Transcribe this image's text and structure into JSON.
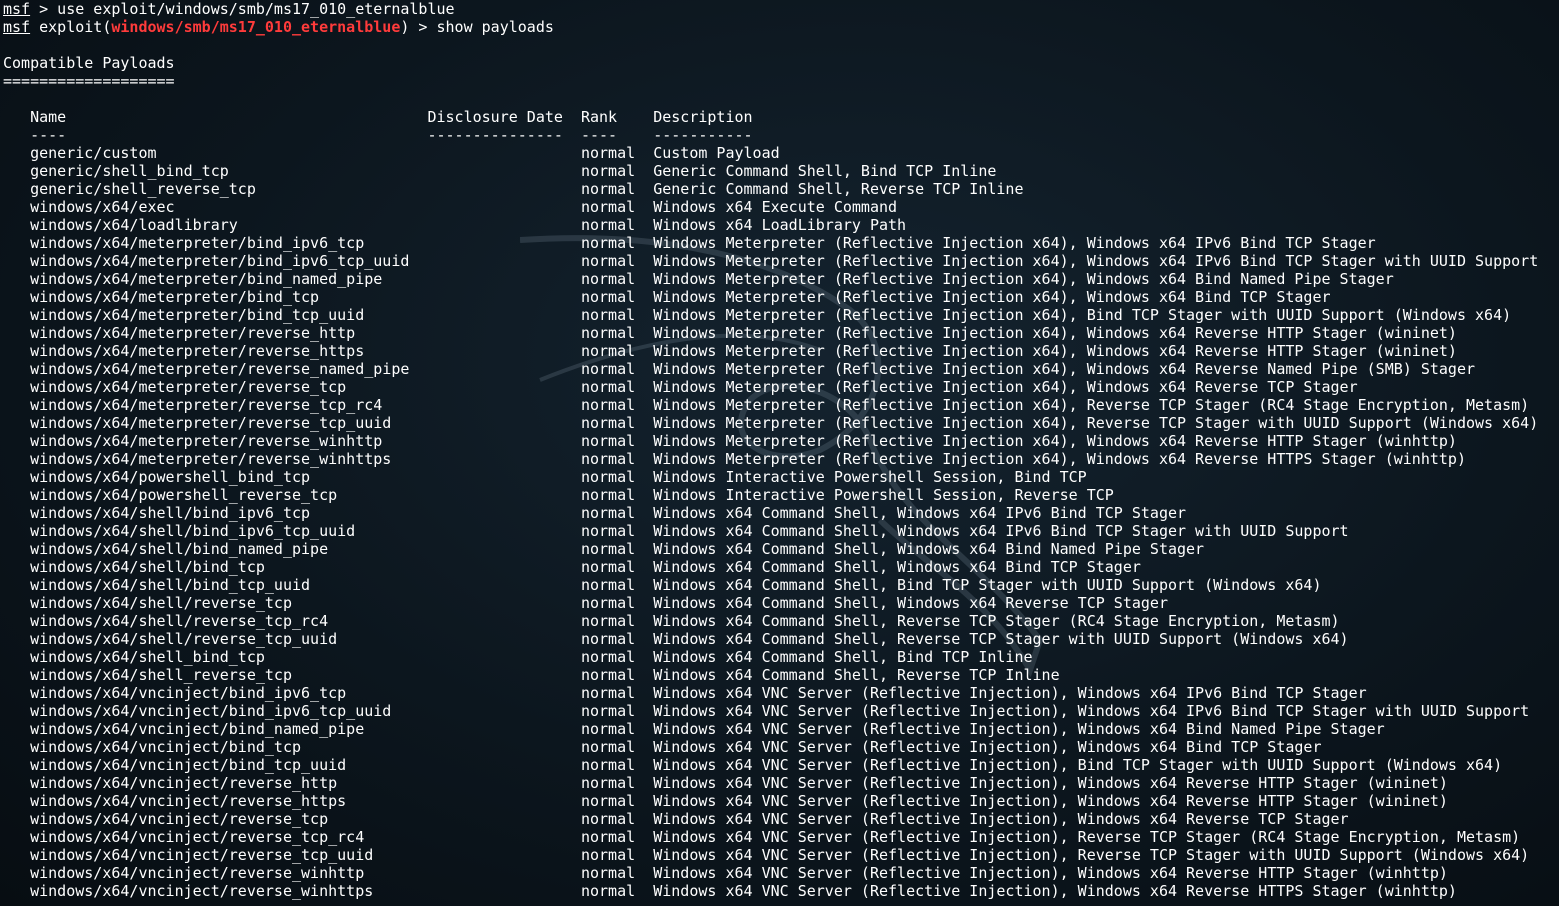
{
  "prompt": {
    "line1": {
      "msf": "msf",
      "rest": " > use exploit/windows/smb/ms17_010_eternalblue"
    },
    "line2": {
      "msf": "msf",
      "pre": " exploit(",
      "module": "windows/smb/ms17_010_eternalblue",
      "post": ") > show payloads"
    }
  },
  "section": {
    "title": "Compatible Payloads",
    "underline": "==================="
  },
  "table": {
    "header": "   Name                                        Disclosure Date  Rank    Description",
    "divider": "   ----                                        ---------------  ----    -----------",
    "rows": [
      "   generic/custom                                               normal  Custom Payload",
      "   generic/shell_bind_tcp                                       normal  Generic Command Shell, Bind TCP Inline",
      "   generic/shell_reverse_tcp                                    normal  Generic Command Shell, Reverse TCP Inline",
      "   windows/x64/exec                                             normal  Windows x64 Execute Command",
      "   windows/x64/loadlibrary                                      normal  Windows x64 LoadLibrary Path",
      "   windows/x64/meterpreter/bind_ipv6_tcp                        normal  Windows Meterpreter (Reflective Injection x64), Windows x64 IPv6 Bind TCP Stager",
      "   windows/x64/meterpreter/bind_ipv6_tcp_uuid                   normal  Windows Meterpreter (Reflective Injection x64), Windows x64 IPv6 Bind TCP Stager with UUID Support",
      "   windows/x64/meterpreter/bind_named_pipe                      normal  Windows Meterpreter (Reflective Injection x64), Windows x64 Bind Named Pipe Stager",
      "   windows/x64/meterpreter/bind_tcp                             normal  Windows Meterpreter (Reflective Injection x64), Windows x64 Bind TCP Stager",
      "   windows/x64/meterpreter/bind_tcp_uuid                        normal  Windows Meterpreter (Reflective Injection x64), Bind TCP Stager with UUID Support (Windows x64)",
      "   windows/x64/meterpreter/reverse_http                         normal  Windows Meterpreter (Reflective Injection x64), Windows x64 Reverse HTTP Stager (wininet)",
      "   windows/x64/meterpreter/reverse_https                        normal  Windows Meterpreter (Reflective Injection x64), Windows x64 Reverse HTTP Stager (wininet)",
      "   windows/x64/meterpreter/reverse_named_pipe                   normal  Windows Meterpreter (Reflective Injection x64), Windows x64 Reverse Named Pipe (SMB) Stager",
      "   windows/x64/meterpreter/reverse_tcp                          normal  Windows Meterpreter (Reflective Injection x64), Windows x64 Reverse TCP Stager",
      "   windows/x64/meterpreter/reverse_tcp_rc4                      normal  Windows Meterpreter (Reflective Injection x64), Reverse TCP Stager (RC4 Stage Encryption, Metasm)",
      "   windows/x64/meterpreter/reverse_tcp_uuid                     normal  Windows Meterpreter (Reflective Injection x64), Reverse TCP Stager with UUID Support (Windows x64)",
      "   windows/x64/meterpreter/reverse_winhttp                      normal  Windows Meterpreter (Reflective Injection x64), Windows x64 Reverse HTTP Stager (winhttp)",
      "   windows/x64/meterpreter/reverse_winhttps                     normal  Windows Meterpreter (Reflective Injection x64), Windows x64 Reverse HTTPS Stager (winhttp)",
      "   windows/x64/powershell_bind_tcp                              normal  Windows Interactive Powershell Session, Bind TCP",
      "   windows/x64/powershell_reverse_tcp                           normal  Windows Interactive Powershell Session, Reverse TCP",
      "   windows/x64/shell/bind_ipv6_tcp                              normal  Windows x64 Command Shell, Windows x64 IPv6 Bind TCP Stager",
      "   windows/x64/shell/bind_ipv6_tcp_uuid                         normal  Windows x64 Command Shell, Windows x64 IPv6 Bind TCP Stager with UUID Support",
      "   windows/x64/shell/bind_named_pipe                            normal  Windows x64 Command Shell, Windows x64 Bind Named Pipe Stager",
      "   windows/x64/shell/bind_tcp                                   normal  Windows x64 Command Shell, Windows x64 Bind TCP Stager",
      "   windows/x64/shell/bind_tcp_uuid                              normal  Windows x64 Command Shell, Bind TCP Stager with UUID Support (Windows x64)",
      "   windows/x64/shell/reverse_tcp                                normal  Windows x64 Command Shell, Windows x64 Reverse TCP Stager",
      "   windows/x64/shell/reverse_tcp_rc4                            normal  Windows x64 Command Shell, Reverse TCP Stager (RC4 Stage Encryption, Metasm)",
      "   windows/x64/shell/reverse_tcp_uuid                           normal  Windows x64 Command Shell, Reverse TCP Stager with UUID Support (Windows x64)",
      "   windows/x64/shell_bind_tcp                                   normal  Windows x64 Command Shell, Bind TCP Inline",
      "   windows/x64/shell_reverse_tcp                                normal  Windows x64 Command Shell, Reverse TCP Inline",
      "   windows/x64/vncinject/bind_ipv6_tcp                          normal  Windows x64 VNC Server (Reflective Injection), Windows x64 IPv6 Bind TCP Stager",
      "   windows/x64/vncinject/bind_ipv6_tcp_uuid                     normal  Windows x64 VNC Server (Reflective Injection), Windows x64 IPv6 Bind TCP Stager with UUID Support",
      "   windows/x64/vncinject/bind_named_pipe                        normal  Windows x64 VNC Server (Reflective Injection), Windows x64 Bind Named Pipe Stager",
      "   windows/x64/vncinject/bind_tcp                               normal  Windows x64 VNC Server (Reflective Injection), Windows x64 Bind TCP Stager",
      "   windows/x64/vncinject/bind_tcp_uuid                          normal  Windows x64 VNC Server (Reflective Injection), Bind TCP Stager with UUID Support (Windows x64)",
      "   windows/x64/vncinject/reverse_http                           normal  Windows x64 VNC Server (Reflective Injection), Windows x64 Reverse HTTP Stager (wininet)",
      "   windows/x64/vncinject/reverse_https                          normal  Windows x64 VNC Server (Reflective Injection), Windows x64 Reverse HTTP Stager (wininet)",
      "   windows/x64/vncinject/reverse_tcp                            normal  Windows x64 VNC Server (Reflective Injection), Windows x64 Reverse TCP Stager",
      "   windows/x64/vncinject/reverse_tcp_rc4                        normal  Windows x64 VNC Server (Reflective Injection), Reverse TCP Stager (RC4 Stage Encryption, Metasm)",
      "   windows/x64/vncinject/reverse_tcp_uuid                       normal  Windows x64 VNC Server (Reflective Injection), Reverse TCP Stager with UUID Support (Windows x64)",
      "   windows/x64/vncinject/reverse_winhttp                        normal  Windows x64 VNC Server (Reflective Injection), Windows x64 Reverse HTTP Stager (winhttp)",
      "   windows/x64/vncinject/reverse_winhttps                       normal  Windows x64 VNC Server (Reflective Injection), Windows x64 Reverse HTTPS Stager (winhttp)"
    ]
  },
  "colors": {
    "background": "#0c161e",
    "text": "#ffffff",
    "module_highlight": "#ff3b3b"
  }
}
